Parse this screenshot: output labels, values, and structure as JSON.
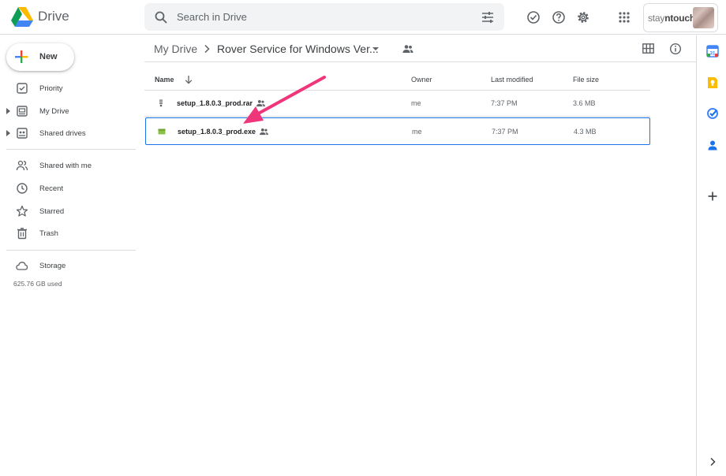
{
  "app": {
    "name": "Drive"
  },
  "search": {
    "placeholder": "Search in Drive"
  },
  "account": {
    "brand_pre": "stay",
    "brand_mid": "n",
    "brand_post": "touch"
  },
  "sidebar": {
    "new_label": "New",
    "items": [
      {
        "label": "Priority",
        "icon": "priority-icon"
      },
      {
        "label": "My Drive",
        "icon": "my-drive-icon"
      },
      {
        "label": "Shared drives",
        "icon": "shared-drives-icon"
      },
      {
        "label": "Shared with me",
        "icon": "shared-with-me-icon"
      },
      {
        "label": "Recent",
        "icon": "recent-icon"
      },
      {
        "label": "Starred",
        "icon": "star-icon"
      },
      {
        "label": "Trash",
        "icon": "trash-icon"
      },
      {
        "label": "Storage",
        "icon": "cloud-icon"
      }
    ],
    "storage_used": "625.76 GB used"
  },
  "breadcrumb": {
    "root": "My Drive",
    "current": "Rover Service for Windows Ver..."
  },
  "table": {
    "columns": {
      "name": "Name",
      "owner": "Owner",
      "modified": "Last modified",
      "size": "File size"
    },
    "rows": [
      {
        "name": "setup_1.8.0.3_prod.rar",
        "owner": "me",
        "modified": "7:37 PM",
        "size": "3.6 MB",
        "icon": "archive-file-icon",
        "selected": false
      },
      {
        "name": "setup_1.8.0.3_prod.exe",
        "owner": "me",
        "modified": "7:37 PM",
        "size": "4.3 MB",
        "icon": "executable-file-icon",
        "selected": true
      }
    ]
  },
  "colors": {
    "accent": "#1a73e8",
    "annotation_arrow": "#f0367a"
  }
}
